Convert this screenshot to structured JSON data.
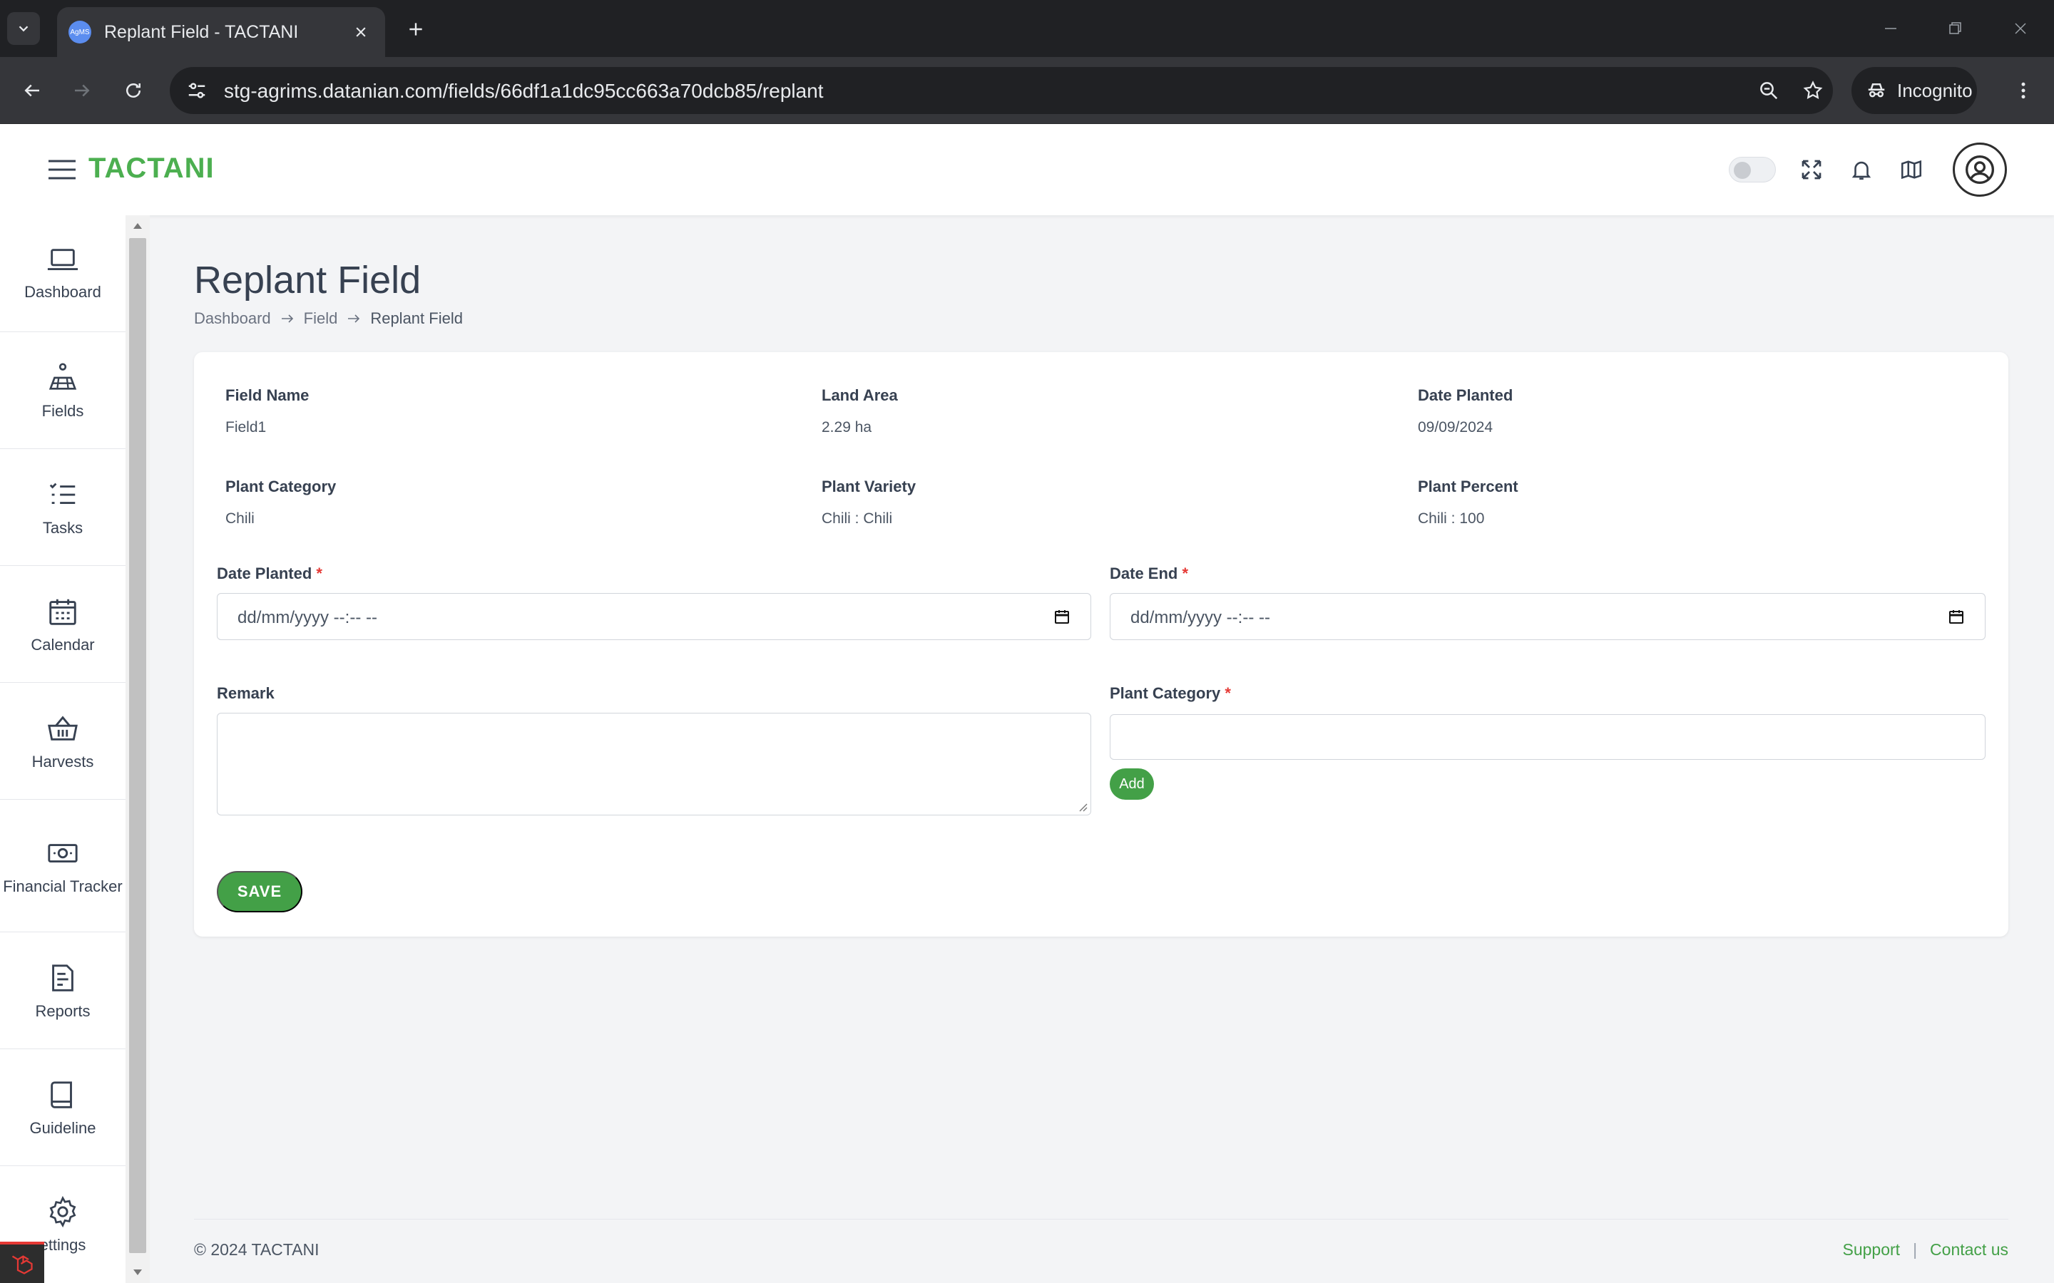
{
  "browser": {
    "tab_title": "Replant Field - TACTANI",
    "favicon_text": "AgMS",
    "url": "stg-agrims.datanian.com/fields/66df1a1dc95cc663a70dcb85/replant",
    "incognito_label": "Incognito"
  },
  "header": {
    "brand": "TACTANI"
  },
  "sidebar": {
    "items": [
      {
        "label": "Dashboard",
        "icon": "laptop-icon"
      },
      {
        "label": "Fields",
        "icon": "field-icon"
      },
      {
        "label": "Tasks",
        "icon": "tasks-icon"
      },
      {
        "label": "Calendar",
        "icon": "calendar-icon"
      },
      {
        "label": "Harvests",
        "icon": "basket-icon"
      },
      {
        "label": "Financial Tracker",
        "icon": "money-icon"
      },
      {
        "label": "Reports",
        "icon": "report-icon"
      },
      {
        "label": "Guideline",
        "icon": "book-icon"
      },
      {
        "label": "ettings",
        "icon": "gear-icon"
      }
    ]
  },
  "page": {
    "title": "Replant Field",
    "breadcrumb": [
      "Dashboard",
      "Field",
      "Replant Field"
    ]
  },
  "info": {
    "field_name_label": "Field Name",
    "field_name": "Field1",
    "land_area_label": "Land Area",
    "land_area": "2.29 ha",
    "date_planted_label": "Date Planted",
    "date_planted": "09/09/2024",
    "plant_category_label": "Plant Category",
    "plant_category": "Chili",
    "plant_variety_label": "Plant Variety",
    "plant_variety": "Chili : Chili",
    "plant_percent_label": "Plant Percent",
    "plant_percent": "Chili : 100"
  },
  "form": {
    "date_planted_label": "Date Planted",
    "date_end_label": "Date End",
    "required_mark": "*",
    "date_placeholder": "dd/mm/yyyy --:-- --",
    "remark_label": "Remark",
    "remark_value": "",
    "plant_category_label": "Plant Category",
    "plant_category_value": "",
    "add_label": "Add",
    "save_label": "SAVE"
  },
  "footer": {
    "copyright": "© 2024 TACTANI",
    "support": "Support",
    "separator": "|",
    "contact": "Contact us"
  },
  "colors": {
    "brand_green": "#4caf50",
    "button_green": "#43a047",
    "required_red": "#e53935"
  }
}
